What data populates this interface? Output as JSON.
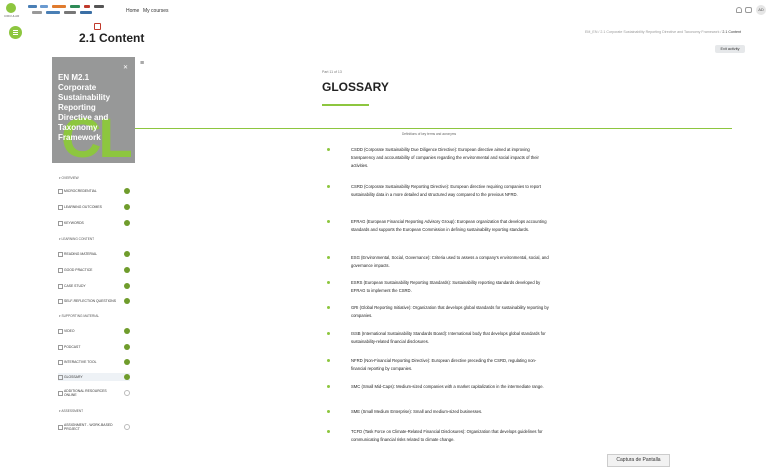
{
  "topbar": {
    "logo_text": "CIRCULAR",
    "nav": [
      "Home",
      "My courses"
    ],
    "avatar_initials": "AD"
  },
  "header": {
    "title": "2.1 Content",
    "breadcrumb": [
      "EM_EN",
      "2.1 Corporate Sustainability Reporting Directive and Taxonomy Framework",
      "2.1 Content"
    ],
    "exit_label": "Exit activity"
  },
  "index": {
    "cover": {
      "title": "EN M2.1 Corporate Sustainability Reporting Directive and Taxonomy Framework",
      "letters": "CL"
    },
    "sections": [
      {
        "label": "OVERVIEW",
        "items": [
          {
            "label": "MICROCREDENTIAL",
            "done": true
          },
          {
            "label": "LEARNING OUTCOMES",
            "done": true
          },
          {
            "label": "KEYWORDS",
            "done": true
          }
        ]
      },
      {
        "label": "LEARNING CONTENT",
        "items": [
          {
            "label": "READING MATERIAL",
            "done": true
          },
          {
            "label": "GOOD PRACTICE",
            "done": true
          },
          {
            "label": "CASE STUDY",
            "done": true
          },
          {
            "label": "SELF-REFLECTION QUESTIONS",
            "done": true
          }
        ]
      },
      {
        "label": "SUPPORTING MATERIAL",
        "items": [
          {
            "label": "VIDEO",
            "done": true
          },
          {
            "label": "PODCAST",
            "done": true
          },
          {
            "label": "INTERACTIVE TOOL",
            "done": true
          },
          {
            "label": "GLOSSARY",
            "done": true
          },
          {
            "label": "ADDITIONAL RESOURCES ONLINE",
            "done": false
          }
        ]
      },
      {
        "label": "ASSESSMENT",
        "items": [
          {
            "label": "ASSIGNMENT - WORK-BASED PROJECT",
            "done": false
          }
        ]
      }
    ]
  },
  "main": {
    "part_label": "Part 11 of 13",
    "title": "GLOSSARY",
    "caption": "Definitions of key terms and acronyms",
    "entries": [
      {
        "text": "CSDD (Corporate Sustainability Due Diligence Directive): European directive aimed at improving transparency and accountability of companies regarding the environmental and social impacts of their activities."
      },
      {
        "text": "CSRD (Corporate Sustainability Reporting Directive): European directive requiring companies to report sustainability data in a more detailed and structured way compared to the previous NFRD."
      },
      {
        "text": "EFRAG (European Financial Reporting Advisory Group): European organization that develops accounting standards and supports the European Commission in defining sustainability reporting standards."
      },
      {
        "text": "ESG (Environmental, Social, Governance): Criteria used to assess a company's environmental, social, and governance impacts."
      },
      {
        "text": "ESRS (European Sustainability Reporting Standards): Sustainability reporting standards developed by EFRAG to implement the CSRD."
      },
      {
        "text": "GRI (Global Reporting Initiative): Organization that develops global standards for sustainability reporting by companies."
      },
      {
        "text": "ISSB (International Sustainability Standards Board): International body that develops global standards for sustainability-related financial disclosures."
      },
      {
        "text": "NFRD (Non-Financial Reporting Directive): European directive preceding the CSRD, regulating non-financial reporting by companies."
      },
      {
        "text": "SMC (Small Mid-Caps): Medium-sized companies with a market capitalization in the intermediate range."
      },
      {
        "text": "SME (Small Medium Enterprise): Small and medium-sized businesses."
      },
      {
        "text": "TCFD (Task Force on Climate-Related Financial Disclosures): Organization that develops guidelines for communicating financial risks related to climate change."
      }
    ]
  },
  "overlay": {
    "screenshot_label": "Captura de Pantalla"
  },
  "colors": {
    "accent": "#8dc63f",
    "done": "#6f9c2c",
    "cover_bg": "#979898"
  }
}
